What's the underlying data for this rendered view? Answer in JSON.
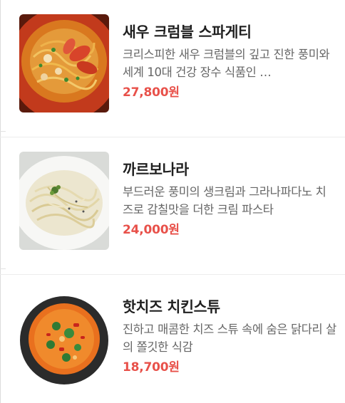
{
  "menu": {
    "items": [
      {
        "name": "새우 크럼블 스파게티",
        "description": "크리스피한 새우 크럼블의 깊고 진한 풍미와 세계 10대 건강 장수 식품인 …",
        "price": "27,800원",
        "image_icon": "shrimp-spaghetti-photo"
      },
      {
        "name": "까르보나라",
        "description": "부드러운 풍미의 생크림과 그라나파다노 치즈로 감칠맛을 더한 크림 파스타",
        "price": "24,000원",
        "image_icon": "carbonara-photo"
      },
      {
        "name": "핫치즈 치킨스튜",
        "description": "진하고 매콤한 치즈 스튜 속에 숨은 닭다리 살의 쫄깃한 식감",
        "price": "18,700원",
        "image_icon": "chicken-stew-photo"
      }
    ]
  },
  "colors": {
    "price": "#e8514a",
    "title": "#1f1f1f",
    "description": "#666666",
    "divider": "#ececec"
  }
}
